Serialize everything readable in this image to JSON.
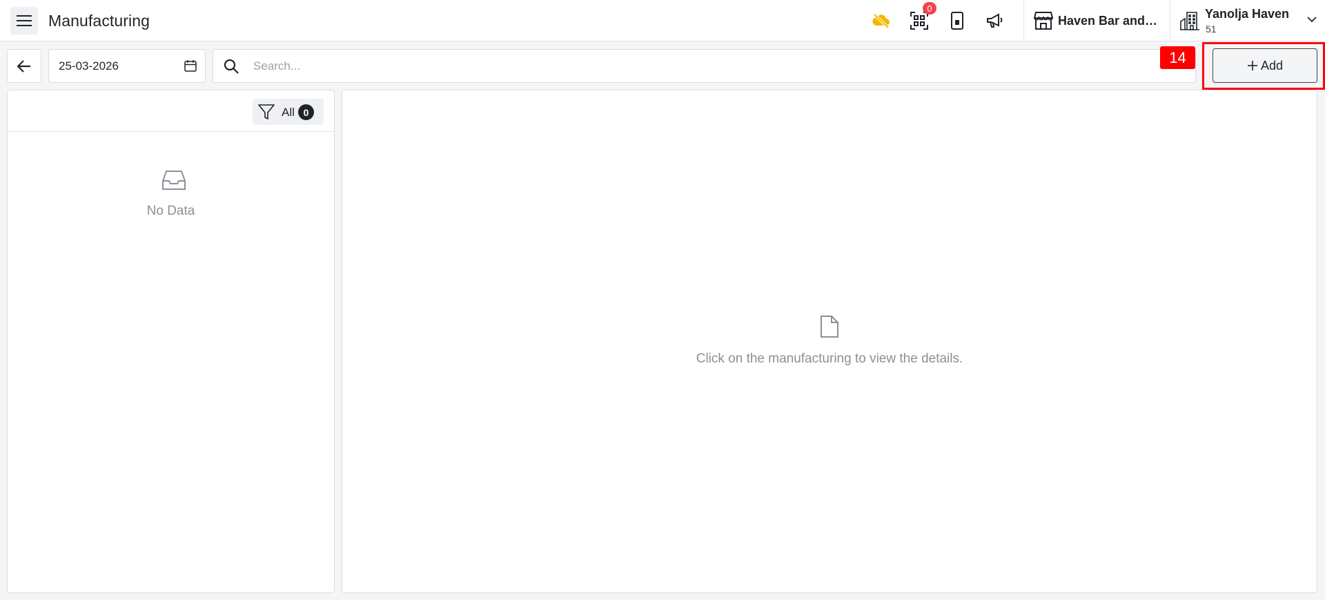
{
  "header": {
    "title": "Manufacturing",
    "qr_badge_count": "0",
    "store_name": "Haven Bar and Restaurant",
    "org_name": "Yanolja Haven",
    "org_id": "51",
    "icons": [
      "menu-icon",
      "cloud-off-icon",
      "qr-scan-icon",
      "mobile-icon",
      "megaphone-icon",
      "store-icon",
      "building-icon",
      "chevron-down-icon"
    ],
    "sync_icon_color": "#f5b800"
  },
  "toolbar": {
    "date_value": "25-03-2026",
    "search_placeholder": "Search...",
    "add_label": "Add",
    "annotation_number": "14",
    "annotation_color": "#ff0000"
  },
  "left_panel": {
    "filter_label": "All",
    "filter_count": "0",
    "empty_text": "No Data"
  },
  "right_panel": {
    "hint": "Click on the manufacturing to view the details."
  }
}
